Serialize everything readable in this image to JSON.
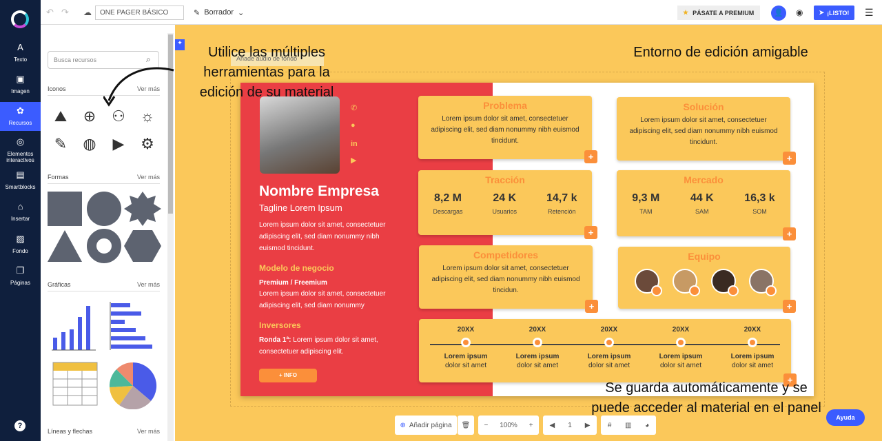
{
  "nav": {
    "items": [
      {
        "label": "Texto",
        "icon": "A"
      },
      {
        "label": "Imagen",
        "icon": "▣"
      },
      {
        "label": "Recursos",
        "icon": "✿"
      },
      {
        "label": "Elementos interactivos",
        "icon": "◎"
      },
      {
        "label": "Smartblocks",
        "icon": "▤"
      },
      {
        "label": "Insertar",
        "icon": "⌂"
      },
      {
        "label": "Fondo",
        "icon": "▨"
      },
      {
        "label": "Páginas",
        "icon": "❐"
      }
    ],
    "help": "?"
  },
  "topbar": {
    "doc_title": "ONE PAGER BÁSICO",
    "status": "Borrador",
    "premium": "PÁSATE A PREMIUM",
    "ready": "¡LISTO!"
  },
  "panel": {
    "search_placeholder": "Busca recursos",
    "sections": [
      {
        "name": "Iconos",
        "more": "Ver más"
      },
      {
        "name": "Formas",
        "more": "Ver más"
      },
      {
        "name": "Gráficas",
        "more": "Ver más"
      },
      {
        "name": "Líneas y flechas",
        "more": "Ver más"
      }
    ]
  },
  "audio": "Añade audio de fondo",
  "slide": {
    "company": "Nombre Empresa",
    "tagline": "Tagline Lorem Ipsum",
    "intro": "Lorem ipsum dolor sit amet, consectetuer adipiscing elit, sed diam nonummy nibh euismod tincidunt.",
    "model_head": "Modelo de negocio",
    "model_sub": "Premium / Freemium",
    "model_text": "Lorem ipsum dolor sit amet, consectetuer adipiscing elit, sed diam nonummy",
    "investors_head": "Inversores",
    "investors_bold": "Ronda 1ª:",
    "investors_text": " Lorem ipsum dolor sit amet, consectetuer adipiscing elit.",
    "info_btn": "+ INFO",
    "problema": {
      "title": "Problema",
      "text": "Lorem ipsum dolor sit amet, consectetuer adipiscing elit, sed diam nonummy nibh euismod tincidunt."
    },
    "solucion": {
      "title": "Solución",
      "text": "Lorem ipsum dolor sit amet, consectetuer adipiscing elit, sed diam nonummy nibh euismod tincidunt."
    },
    "traccion": {
      "title": "Tracción",
      "stats": [
        {
          "v": "8,2 M",
          "l": "Descargas"
        },
        {
          "v": "24 K",
          "l": "Usuarios"
        },
        {
          "v": "14,7 k",
          "l": "Retención"
        }
      ]
    },
    "mercado": {
      "title": "Mercado",
      "stats": [
        {
          "v": "9,3 M",
          "l": "TAM"
        },
        {
          "v": "44 K",
          "l": "SAM"
        },
        {
          "v": "16,3 k",
          "l": "SOM"
        }
      ]
    },
    "competidores": {
      "title": "Competidores",
      "text": "Lorem ipsum dolor sit amet, consectetuer adipiscing elit, sed diam nonummy nibh euismod tincidun."
    },
    "equipo": {
      "title": "Equipo"
    },
    "timeline": [
      {
        "y": "20XX",
        "a": "Lorem ipsum",
        "b": "dolor sit amet"
      },
      {
        "y": "20XX",
        "a": "Lorem ipsum",
        "b": "dolor sit amet"
      },
      {
        "y": "20XX",
        "a": "Lorem ipsum",
        "b": "dolor sit amet"
      },
      {
        "y": "20XX",
        "a": "Lorem ipsum",
        "b": "dolor sit amet"
      },
      {
        "y": "20XX",
        "a": "Lorem ipsum",
        "b": "dolor sit amet"
      }
    ]
  },
  "notes": {
    "tools": "Utilice las múltiples herramientas para la edición de su material",
    "env": "Entorno de edición amigable",
    "save": "Se guarda automáticamente y se puede acceder al material en el panel"
  },
  "bottombar": {
    "add_page": "Añadir página",
    "zoom": "100%",
    "page": "1"
  },
  "ayuda": "Ayuda"
}
